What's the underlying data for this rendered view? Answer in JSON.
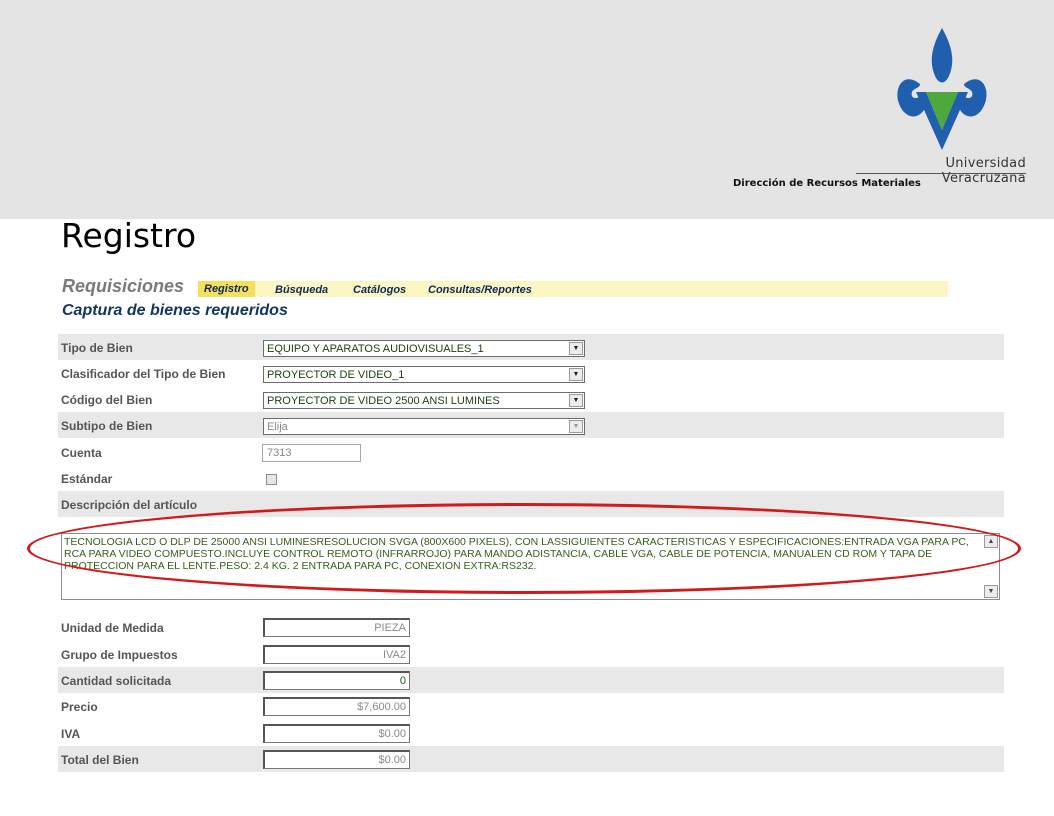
{
  "header": {
    "university": "Universidad Veracruzana",
    "department": "Dirección de Recursos Materiales"
  },
  "slide_title": "Registro",
  "app": {
    "module": "Requisiciones",
    "menu": [
      "Registro",
      "Búsqueda",
      "Catálogos",
      "Consultas/Reportes"
    ],
    "active_menu": "Registro",
    "page_title": "Captura de bienes requeridos"
  },
  "form": {
    "tipo_bien": {
      "label": "Tipo de Bien",
      "value": "EQUIPO Y APARATOS AUDIOVISUALES_1"
    },
    "clasificador": {
      "label": "Clasificador del Tipo de Bien",
      "value": "PROYECTOR DE VIDEO_1"
    },
    "codigo": {
      "label": "Código del Bien",
      "value": "PROYECTOR DE VIDEO 2500 ANSI LUMINES"
    },
    "subtipo": {
      "label": "Subtipo de Bien",
      "value": "Elija"
    },
    "cuenta": {
      "label": "Cuenta",
      "value": "7313"
    },
    "estandar": {
      "label": "Estándar",
      "checked": false
    },
    "descripcion": {
      "label": "Descripción del artículo",
      "value": "TECNOLOGIA LCD O DLP DE 25000 ANSI LUMINESRESOLUCION SVGA (800X600 PIXELS), CON LASSIGUIENTES CARACTERISTICAS Y ESPECIFICACIONES:ENTRADA VGA PARA PC, RCA PARA VIDEO COMPUESTO.INCLUYE CONTROL REMOTO (INFRARROJO) PARA MANDO ADISTANCIA, CABLE VGA, CABLE DE POTENCIA, MANUALEN CD ROM Y TAPA DE PROTECCION PARA EL LENTE.PESO: 2.4 KG. 2 ENTRADA PARA PC, CONEXION EXTRA:RS232."
    },
    "unidad": {
      "label": "Unidad de Medida",
      "value": "PIEZA"
    },
    "impuestos": {
      "label": "Grupo de Impuestos",
      "value": "IVA2"
    },
    "cantidad": {
      "label": "Cantidad solicitada",
      "value": "0"
    },
    "precio": {
      "label": "Precio",
      "value": "$7,600.00"
    },
    "iva": {
      "label": "IVA",
      "value": "$0.00"
    },
    "total": {
      "label": "Total del Bien",
      "value": "$0.00"
    }
  },
  "colors": {
    "banner": "#e4e4e4",
    "logo_blue": "#1f5fad",
    "logo_green": "#4fa83d",
    "menu_bar": "#fbf6c2",
    "menu_active": "#f5df5c",
    "annotation": "#d21a1a"
  }
}
